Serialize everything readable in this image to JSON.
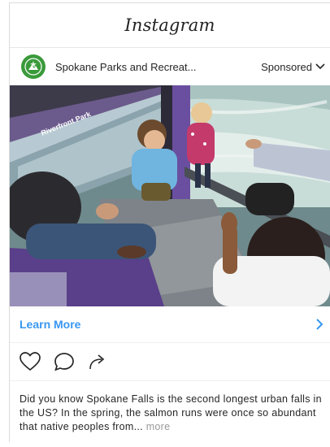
{
  "header": {
    "wordmark": "Instagram"
  },
  "post": {
    "account_name": "Spokane Parks and Recreat...",
    "sponsored_label": "Sponsored",
    "image_alt": "Riverfront Park gondola cabin with visitors looking down at the falls",
    "cta_label": "Learn More",
    "caption_text": "Did you know Spokane Falls is the second longest urban falls in the US? In the spring, the salmon runs were once so abundant that native peoples from...",
    "more_label": " more",
    "gondola_sign": "Riverfront Park"
  },
  "icons": [
    "park-logo-icon",
    "chevron-down-icon",
    "chevron-right-icon",
    "heart-icon",
    "comment-icon",
    "share-icon"
  ],
  "colors": {
    "cta": "#3897f0",
    "avatar": "#3a9a3a",
    "more": "#999999"
  }
}
